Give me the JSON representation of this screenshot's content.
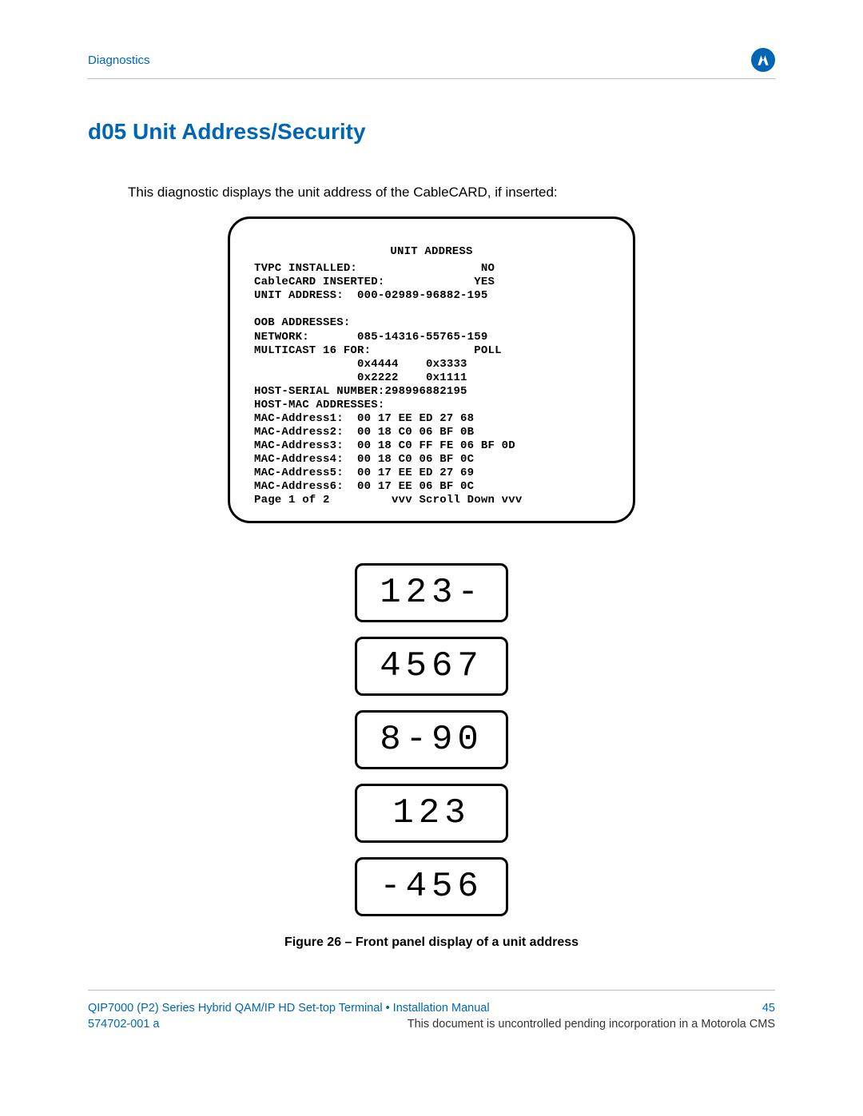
{
  "header": {
    "breadcrumb": "Diagnostics"
  },
  "section": {
    "title": "d05 Unit Address/Security",
    "intro": "This diagnostic displays the unit address of the CableCARD, if inserted:"
  },
  "screen": {
    "title": "UNIT ADDRESS",
    "tvpc_label": "TVPC INSTALLED:",
    "tvpc_value": "NO",
    "cablecard_label": "CableCARD INSERTED:",
    "cablecard_value": "YES",
    "unit_addr_label": "UNIT ADDRESS:",
    "unit_addr_value": "000-02989-96882-195",
    "oob_header": "OOB ADDRESSES:",
    "network_label": "NETWORK:",
    "network_value": "085-14316-55765-159",
    "multicast_label": "MULTICAST 16 FOR:",
    "multicast_poll": "POLL",
    "mc_row1_a": "0x4444",
    "mc_row1_b": "0x3333",
    "mc_row2_a": "0x2222",
    "mc_row2_b": "0x1111",
    "host_serial_label": "HOST-SERIAL NUMBER:",
    "host_serial_value": "298996882195",
    "host_mac_header": "HOST-MAC ADDRESSES:",
    "mac1_label": "MAC-Address1:",
    "mac1_value": "00 17 EE ED 27 68",
    "mac2_label": "MAC-Address2:",
    "mac2_value": "00 18 C0 06 BF 0B",
    "mac3_label": "MAC-Address3:",
    "mac3_value": "00 18 C0 FF FE 06 BF 0D",
    "mac4_label": "MAC-Address4:",
    "mac4_value": "00 18 C0 06 BF 0C",
    "mac5_label": "MAC-Address5:",
    "mac5_value": "00 17 EE ED 27 69",
    "mac6_label": "MAC-Address6:",
    "mac6_value": "00 17 EE 06 BF 0C",
    "page_label": "Page 1 of 2",
    "scroll_hint": "vvv Scroll Down vvv"
  },
  "led": {
    "row1": "123-",
    "row2": "4567",
    "row3": "8-90",
    "row4": "123",
    "row5": "-456"
  },
  "figure": {
    "caption": "Figure 26 – Front panel display of a unit address"
  },
  "footer": {
    "manual": "QIP7000 (P2) Series Hybrid QAM/IP HD Set-top Terminal • Installation Manual",
    "pageno": "45",
    "docnum": "574702-001 a",
    "uncontrolled": "This document is uncontrolled pending incorporation in a Motorola CMS"
  }
}
